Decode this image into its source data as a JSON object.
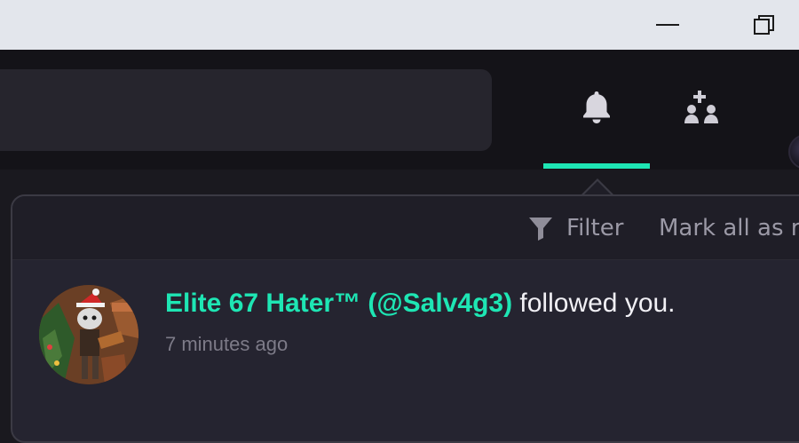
{
  "window": {
    "minimize_icon": "minimize-icon",
    "restore_icon": "restore-icon"
  },
  "appbar": {
    "search_value": "",
    "bell_icon": "bell-icon",
    "friends_icon": "add-friends-icon",
    "accent_color": "#1ee6b4"
  },
  "notifications": {
    "filter_label": "Filter",
    "mark_all_label": "Mark all as r",
    "items": [
      {
        "user": "Elite 67 Hater™ (@Salv4g3)",
        "action": " followed you.",
        "time": "7 minutes ago"
      }
    ]
  }
}
